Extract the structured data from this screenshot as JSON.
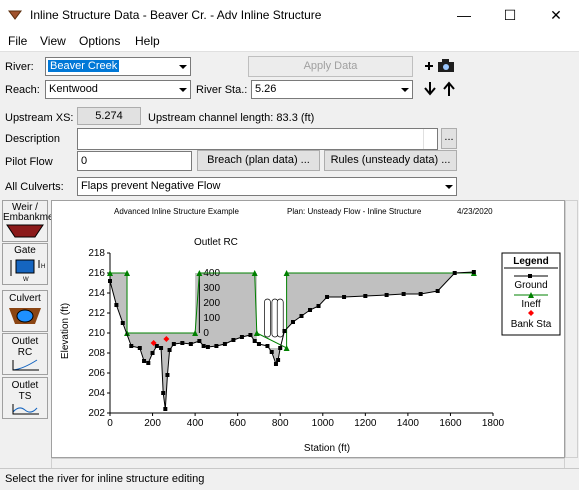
{
  "window": {
    "title": "Inline Structure Data - Beaver Cr. - Adv Inline Structure"
  },
  "menu": [
    "File",
    "View",
    "Options",
    "Help"
  ],
  "form": {
    "river_label": "River:",
    "river_value": "Beaver Creek",
    "reach_label": "Reach:",
    "reach_value": "Kentwood",
    "river_sta_label": "River Sta.:",
    "river_sta_value": "5.26",
    "apply_data": "Apply Data",
    "upstream_xs_label": "Upstream XS:",
    "upstream_xs_value": "5.274",
    "upstream_length": "Upstream channel length: 83.3 (ft)",
    "description_label": "Description",
    "description_button": "...",
    "pilot_flow_label": "Pilot Flow",
    "pilot_flow_value": "0",
    "breach_button": "Breach (plan data) ...",
    "rules_button": "Rules (unsteady data) ...",
    "all_culverts_label": "All Culverts:",
    "all_culverts_value": "Flaps prevent Negative Flow"
  },
  "sidebar": {
    "items": [
      {
        "label": "Weir / Embankment",
        "icon": "weir-icon"
      },
      {
        "label": "Gate",
        "icon": "gate-icon"
      },
      {
        "label": "Culvert",
        "icon": "culvert-icon"
      },
      {
        "label": "Outlet RC",
        "icon": "outlet-rc-icon"
      },
      {
        "label": "Outlet TS",
        "icon": "outlet-ts-icon"
      }
    ]
  },
  "status": "Select the river for inline structure editing",
  "colors": {
    "ground": "#000000",
    "ineff": "#008000",
    "bank": "#ff0000",
    "fill": "#c0c0c0"
  },
  "chart_data": {
    "type": "line",
    "title_left": "Advanced Inline  Structure Example",
    "title_plan": "Plan: Unsteady Flow - Inline Structure",
    "title_date": "4/23/2020",
    "xlabel": "Station (ft)",
    "ylabel": "Elevation (ft)",
    "xlim": [
      0,
      1800
    ],
    "ylim": [
      202,
      218
    ],
    "xticks": [
      "0",
      "200",
      "400",
      "600",
      "800",
      "1000",
      "1200",
      "1400",
      "1600",
      "1800"
    ],
    "yticks": [
      "202",
      "204",
      "206",
      "208",
      "210",
      "212",
      "214",
      "216",
      "218"
    ],
    "inset": {
      "label": "Outlet RC",
      "ticks": [
        "0",
        "100",
        "200",
        "300",
        "400"
      ]
    },
    "legend": {
      "title": "Legend",
      "entries": [
        "Ground",
        "Ineff",
        "Bank Sta"
      ]
    },
    "series": [
      {
        "name": "Ground",
        "x": [
          0,
          30,
          60,
          100,
          140,
          160,
          180,
          200,
          220,
          240,
          250,
          260,
          270,
          280,
          300,
          340,
          380,
          420,
          440,
          460,
          500,
          540,
          580,
          620,
          660,
          680,
          700,
          740,
          760,
          780,
          790,
          800,
          820,
          860,
          900,
          940,
          980,
          1020,
          1100,
          1200,
          1300,
          1380,
          1460,
          1540,
          1620,
          1710
        ],
        "y": [
          215.2,
          212.8,
          211.0,
          208.7,
          208.5,
          207.2,
          207.0,
          208.0,
          208.7,
          208.5,
          204.0,
          202.4,
          205.8,
          208.3,
          208.9,
          209.0,
          208.9,
          209.2,
          208.7,
          208.6,
          208.7,
          208.9,
          209.3,
          209.6,
          209.8,
          209.2,
          208.9,
          208.7,
          208.1,
          206.9,
          207.3,
          208.5,
          210.2,
          211.1,
          211.7,
          212.3,
          212.7,
          213.6,
          213.6,
          213.7,
          213.8,
          213.9,
          213.9,
          214.2,
          216.0,
          216.1
        ]
      },
      {
        "name": "Ineff",
        "x": [
          0,
          80,
          80,
          400,
          420,
          680,
          690,
          830,
          830,
          1710
        ],
        "y": [
          216.0,
          216.0,
          210.0,
          210.0,
          216.0,
          216.0,
          210.0,
          208.5,
          216.0,
          216.0
        ]
      },
      {
        "name": "Bank Sta",
        "x": [
          205,
          265
        ],
        "y": [
          209.0,
          209.4
        ]
      }
    ]
  }
}
